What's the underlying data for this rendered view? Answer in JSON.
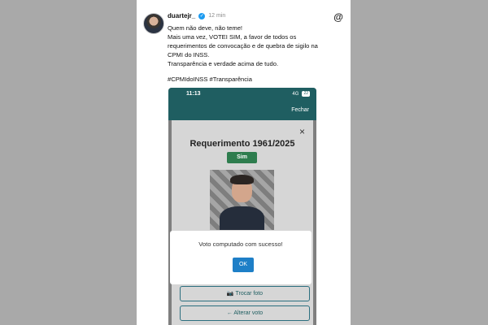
{
  "post": {
    "username": "duartejr_",
    "time": "12 min",
    "lines": [
      "Quem não deve, não teme!",
      "Mais uma vez, VOTEI SIM, a favor de todos os",
      "requerimentos de convocação e de quebra de sigilo na",
      "CPMI do INSS.",
      "Transparência e verdade acima de tudo."
    ],
    "hashtags": "#CPMIdoINSS #Transparência"
  },
  "phone": {
    "time": "11:13",
    "network": "4G",
    "battery": "22",
    "close_label": "Fechar",
    "card_title": "Requerimento 1961/2025",
    "sim_label": "Sim",
    "modal_message": "Voto computado com sucesso!",
    "ok_label": "OK",
    "trocar_foto": "Trocar foto",
    "alterar_voto": "Alterar voto"
  },
  "colors": {
    "teal": "#1f5e61",
    "green": "#2e7d4e",
    "blue": "#1e7fc7",
    "verified": "#1d9bf0"
  },
  "icons": {
    "verified": "verified-badge-icon",
    "threads": "threads-icon",
    "camera": "camera-icon",
    "arrow": "arrow-left-icon",
    "close": "close-icon"
  }
}
